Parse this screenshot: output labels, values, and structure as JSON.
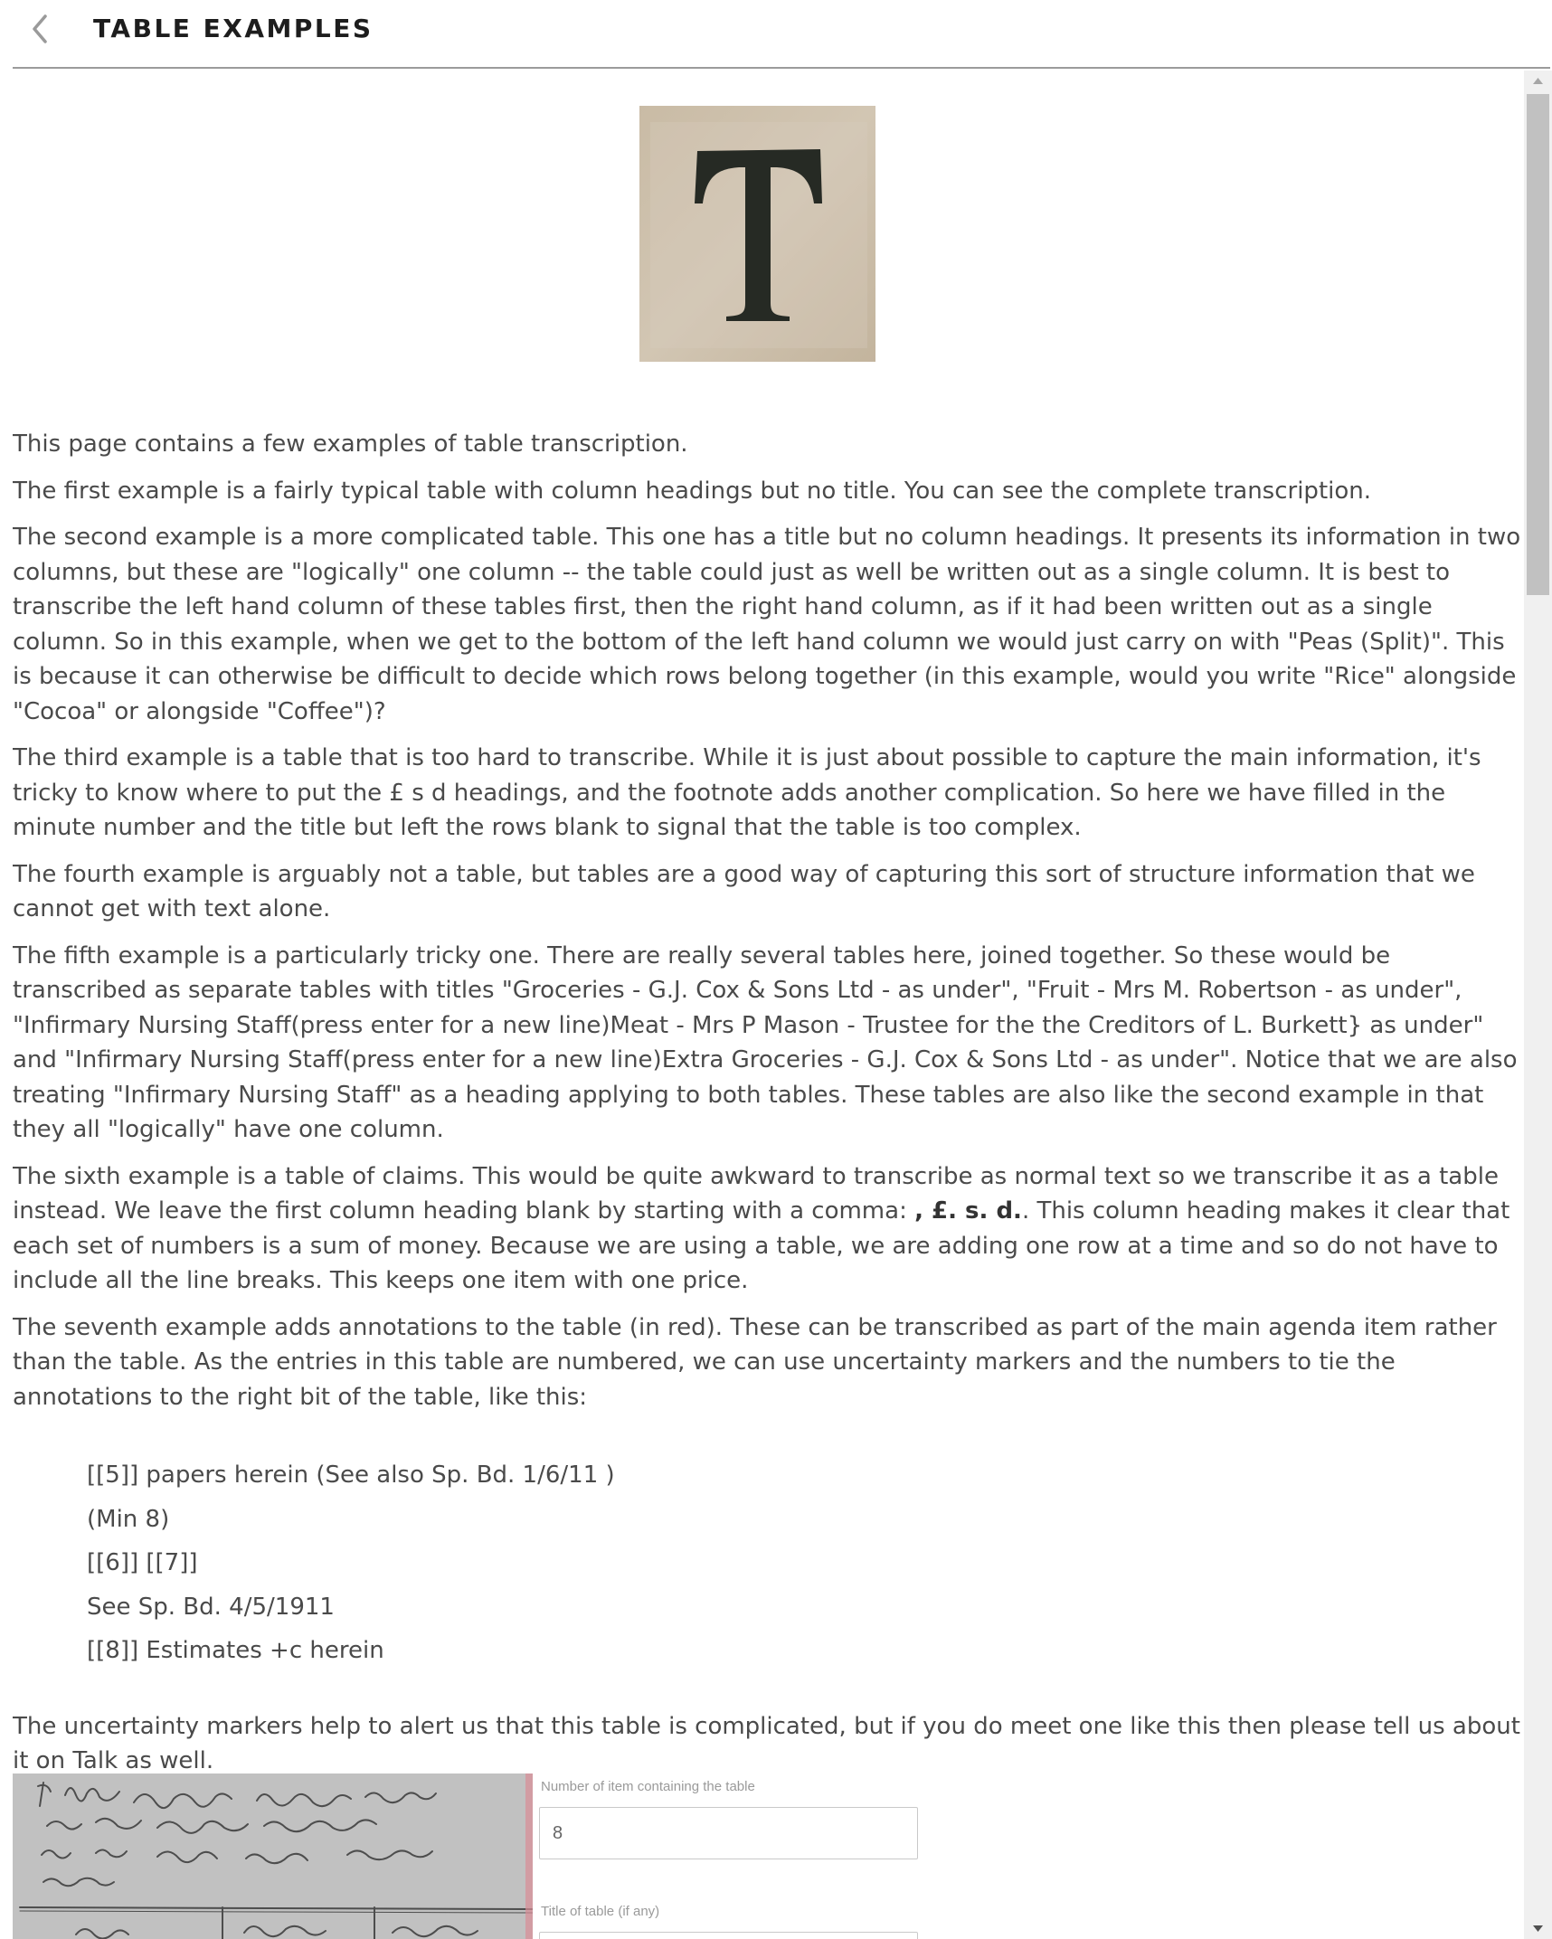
{
  "header": {
    "title": "TABLE EXAMPLES",
    "back_icon": "chevron-left-icon"
  },
  "logo": {
    "letter": "T"
  },
  "paragraphs": [
    "This page contains a few examples of table transcription.",
    "The first example is a fairly typical table with column headings but no title. You can see the complete transcription.",
    "The second example is a more complicated table. This one has a title but no column headings. It presents its information in two columns, but these are \"logically\" one column -- the table could just as well be written out as a single column. It is best to transcribe the left hand column of these tables first, then the right hand column, as if it had been written out as a single column. So in this example, when we get to the bottom of the left hand column we would just carry on with \"Peas (Split)\". This is because it can otherwise be difficult to decide which rows belong together (in this example, would you write \"Rice\" alongside \"Cocoa\" or alongside \"Coffee\")?",
    "The third example is a table that is too hard to transcribe. While it is just about possible to capture the main information, it's tricky to know where to put the £ s d headings, and the footnote adds another complication. So here we have filled in the minute number and the title but left the rows blank to signal that the table is too complex.",
    "The fourth example is arguably not a table, but tables are a good way of capturing this sort of structure information that we cannot get with text alone.",
    "The fifth example is a particularly tricky one. There are really several tables here, joined together. So these would be transcribed as separate tables with titles \"Groceries - G.J. Cox & Sons Ltd - as under\", \"Fruit - Mrs M. Robertson - as under\", \"Infirmary Nursing Staff(press enter for a new line)Meat - Mrs P Mason - Trustee for the the Creditors of L. Burkett} as under\" and \"Infirmary Nursing Staff(press enter for a new line)Extra Groceries - G.J. Cox & Sons Ltd - as under\". Notice that we are also treating \"Infirmary Nursing Staff\" as a heading applying to both tables. These tables are also like the second example in that they all \"logically\" have one column."
  ],
  "sixth": {
    "part1": "The sixth example is a table of claims. This would be quite awkward to transcribe as normal text so we transcribe it as a table instead. We leave the first column heading blank by starting with a comma: ",
    "bold": ", £. s. d.",
    "part2": ". This column heading makes it clear that each set of numbers is a sum of money. Because we are using a table, we are adding one row at a time and so do not have to include all the line breaks. This keeps one item with one price."
  },
  "seventh": "The seventh example adds annotations to the table (in red). These can be transcribed as part of the main agenda item rather than the table. As the entries in this table are numbered, we can use uncertainty markers and the numbers to tie the annotations to the right bit of the table, like this:",
  "annotations": [
    "[[5]] papers herein (See also Sp. Bd. 1/6/11 )",
    "(Min 8)",
    "[[6]] [[7]]",
    "See Sp. Bd. 4/5/1911",
    "[[8]] Estimates +c herein"
  ],
  "closing": "The uncertainty markers help to alert us that this table is complicated, but if you do meet one like this then please tell us about it on Talk as well.",
  "example_form": {
    "item_label": "Number of item containing the table",
    "item_value": "8",
    "title_label": "Title of table (if any)"
  }
}
